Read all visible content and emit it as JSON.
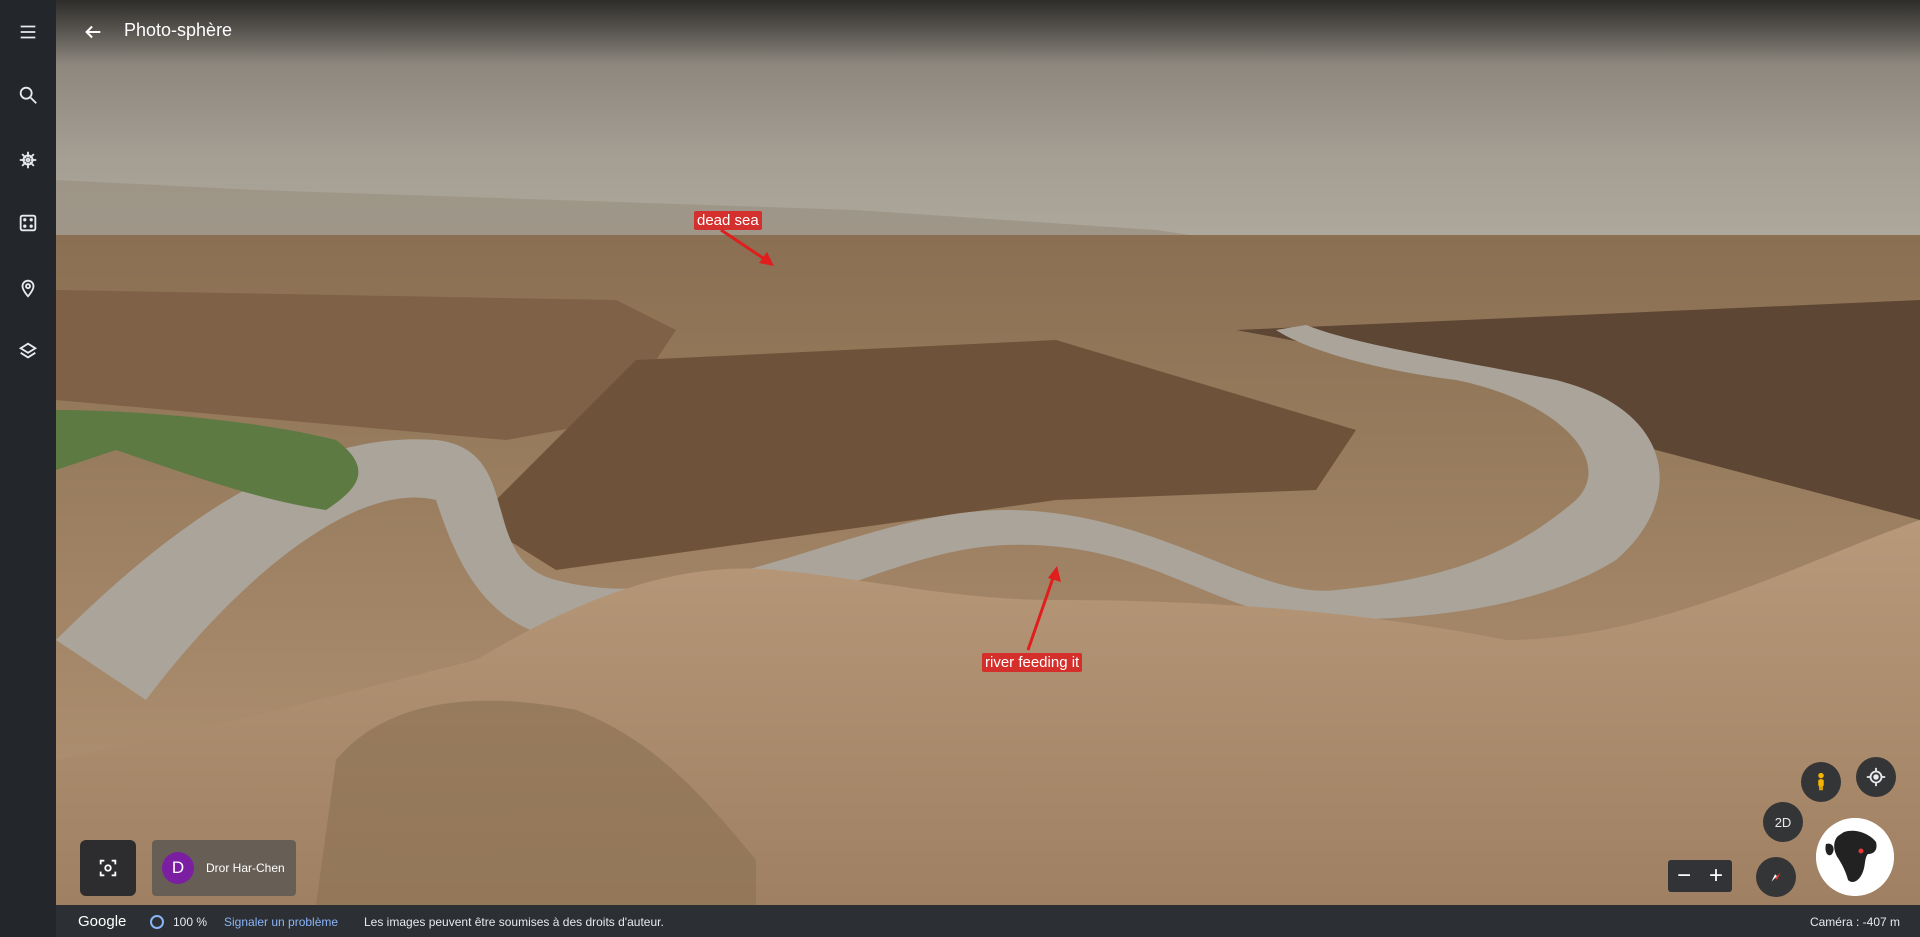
{
  "title": "Photo-sphère",
  "annotations": {
    "dead_sea": "dead sea",
    "river": "river feeding it"
  },
  "author": {
    "initial": "D",
    "name": "Dror Har-Chen"
  },
  "statusbar": {
    "logo": "Google",
    "zoom": "100 %",
    "report": "Signaler un problème",
    "rights": "Les images peuvent être soumises à des droits d'auteur.",
    "camera": "Caméra : -407 m"
  },
  "controls": {
    "mode_2d": "2D",
    "zoom_out": "−",
    "zoom_in": "+"
  },
  "colors": {
    "rail": "#23262b",
    "annotation": "#dc1e1e",
    "link": "#8ab4f8",
    "avatar": "#7b1fa2"
  },
  "icons": [
    "menu-icon",
    "search-icon",
    "ship-wheel-icon",
    "dice-icon",
    "pin-icon",
    "layers-icon",
    "back-arrow-icon",
    "focus-icon",
    "pegman-icon",
    "my-location-icon",
    "compass-icon"
  ]
}
